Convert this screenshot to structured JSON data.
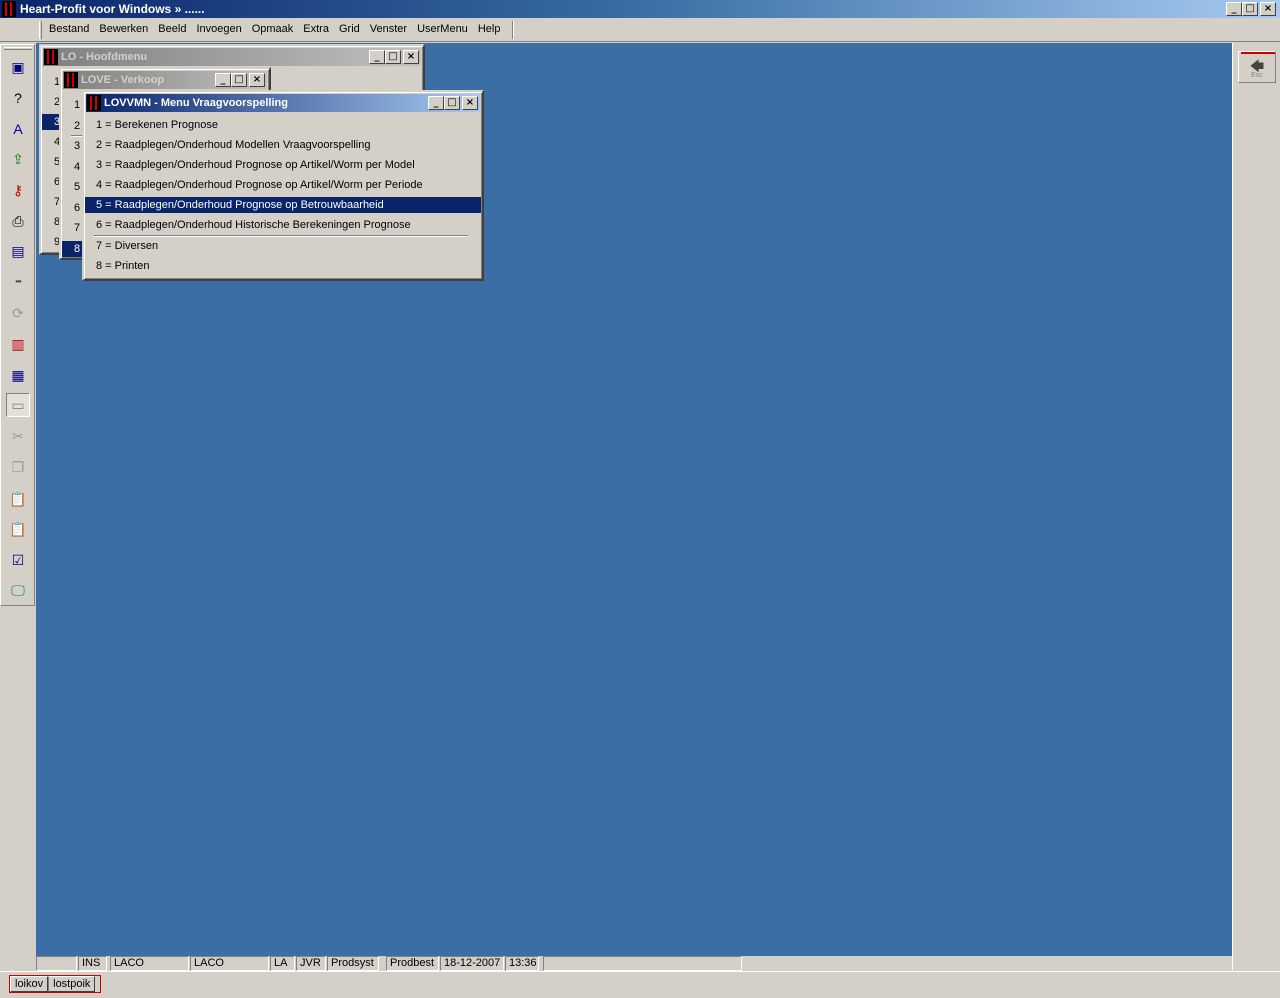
{
  "app": {
    "title": "Heart-Profit voor Windows  »  ......",
    "window_buttons": {
      "minimize": "_",
      "maximize": "□",
      "close": "×"
    }
  },
  "menubar": {
    "items": [
      "Bestand",
      "Bewerken",
      "Beeld",
      "Invoegen",
      "Opmaak",
      "Extra",
      "Grid",
      "Venster",
      "UserMenu",
      "Help"
    ]
  },
  "toolbar": {
    "tools": [
      {
        "icon": "window-icon",
        "glyph": "▣",
        "color": "#00007f",
        "disabled": false
      },
      {
        "icon": "help-icon",
        "glyph": "?",
        "color": "#000000",
        "disabled": false
      },
      {
        "icon": "spelling-icon",
        "glyph": "A",
        "color": "#0000aa",
        "disabled": false
      },
      {
        "icon": "export-icon",
        "glyph": "⇪",
        "color": "#007f00",
        "disabled": false
      },
      {
        "icon": "key-icon",
        "glyph": "⚷",
        "color": "#c00000",
        "disabled": false
      },
      {
        "icon": "printer-icon",
        "glyph": "⎙",
        "color": "#000000",
        "disabled": false
      },
      {
        "icon": "form-icon",
        "glyph": "▤",
        "color": "#00007f",
        "disabled": false
      },
      {
        "icon": "ellipsis-icon",
        "glyph": "•••",
        "color": "#404040",
        "disabled": false
      },
      {
        "icon": "refresh-icon",
        "glyph": "⟳",
        "color": "#9a9a9a",
        "disabled": true
      },
      {
        "icon": "edit-form-icon",
        "glyph": "▥",
        "color": "#c00000",
        "disabled": false
      },
      {
        "icon": "report-icon",
        "glyph": "▦",
        "color": "#00007f",
        "disabled": false
      },
      {
        "icon": "panel-icon",
        "glyph": "▭",
        "color": "#808080",
        "disabled": false,
        "pressed": true
      },
      {
        "icon": "cut-icon",
        "glyph": "✂",
        "color": "#9a9a9a",
        "disabled": true
      },
      {
        "icon": "copy-icon",
        "glyph": "❐",
        "color": "#9a9a9a",
        "disabled": true
      },
      {
        "icon": "paste-icon",
        "glyph": "📋",
        "color": "#9a9a9a",
        "disabled": true
      },
      {
        "icon": "paste-special-icon",
        "glyph": "📋",
        "color": "#9a9a9a",
        "disabled": true
      },
      {
        "icon": "properties-icon",
        "glyph": "☑",
        "color": "#00007f",
        "disabled": false
      },
      {
        "icon": "monitor-icon",
        "glyph": "🖵",
        "color": "#007f7f",
        "disabled": false
      }
    ]
  },
  "right_panel": {
    "esc_arrow": "🡄",
    "esc_label": "Esc"
  },
  "windows": {
    "hoofdmenu": {
      "title": "LO - Hoofdmenu",
      "rows": [
        "1",
        "2",
        "3",
        "4",
        "5",
        "6",
        "7",
        "8",
        "9"
      ],
      "selected_index": 2
    },
    "verkoop": {
      "title": "LOVE - Verkoop",
      "rows": [
        "1",
        "2",
        "3",
        "4",
        "5",
        "6",
        "7",
        "8"
      ],
      "selected_index": 7
    },
    "vraagvoorspelling": {
      "title": "LOVVMN - Menu Vraagvoorspelling",
      "rows": [
        "1 = Berekenen Prognose",
        "2 = Raadplegen/Onderhoud Modellen Vraagvoorspelling",
        "3 = Raadplegen/Onderhoud Prognose op Artikel/Worm per Model",
        "4 = Raadplegen/Onderhoud Prognose op Artikel/Worm per Periode",
        "5 = Raadplegen/Onderhoud Prognose op Betrouwbaarheid",
        "6 = Raadplegen/Onderhoud Historische Berekeningen Prognose",
        "7 = Diversen",
        "8 = Printen"
      ],
      "selected_index": 4
    }
  },
  "statusbar": {
    "cells": [
      "",
      "INS",
      "LACO",
      "LACO",
      "LA",
      "JVR",
      "Prodsyst",
      "Prodbest",
      "18-12-2007",
      "13:36",
      ""
    ]
  },
  "taskbar": {
    "buttons": [
      "loikov",
      "lostpoik"
    ]
  },
  "colors": {
    "desktop": "#3a6ea5",
    "selection": "#0a246a",
    "face": "#d4d0c8",
    "accent_red": "#cc0000"
  }
}
